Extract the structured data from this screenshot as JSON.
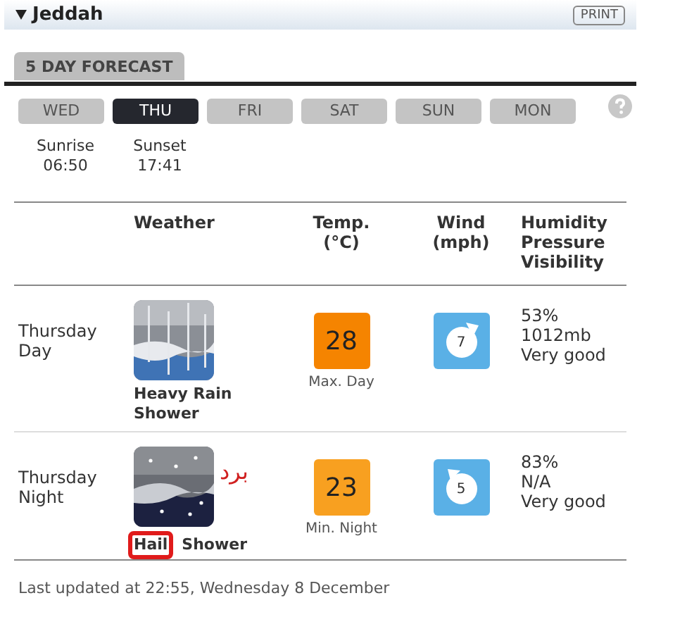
{
  "location": {
    "name": "Jeddah",
    "expanded": true,
    "print_label": "PRINT"
  },
  "section_tab": "5 DAY FORECAST",
  "days": [
    {
      "label": "WED",
      "selected": false
    },
    {
      "label": "THU",
      "selected": true
    },
    {
      "label": "FRI",
      "selected": false
    },
    {
      "label": "SAT",
      "selected": false
    },
    {
      "label": "SUN",
      "selected": false
    },
    {
      "label": "MON",
      "selected": false
    }
  ],
  "sun": [
    {
      "label": "Sunrise",
      "time": "06:50"
    },
    {
      "label": "Sunset",
      "time": "17:41"
    }
  ],
  "table": {
    "columns": [
      "Weather",
      "Temp.\n(°C)",
      "Wind\n(mph)",
      "Humidity\nPressure\nVisibility"
    ],
    "rows": [
      {
        "period": "Thursday\nDay",
        "weather": "Heavy Rain\nShower",
        "temp": "28",
        "temp_label": "Max. Day",
        "color": "#f58400",
        "wind": "7",
        "humidity": "53%",
        "pressure": "1012mb",
        "visibility": "Very good"
      },
      {
        "period": "Thursday\nNight",
        "weather_words": [
          {
            "text": "Hail",
            "highlighted": true
          },
          {
            "text": "Shower",
            "highlighted": false
          }
        ],
        "note": "برد",
        "temp": "23",
        "temp_label": "Min. Night",
        "color": "#f8a020",
        "wind": "5",
        "humidity": "83%",
        "pressure": "N/A",
        "visibility": "Very good"
      }
    ]
  },
  "last_updated": "Last updated at 22:55, Wednesday 8 December"
}
